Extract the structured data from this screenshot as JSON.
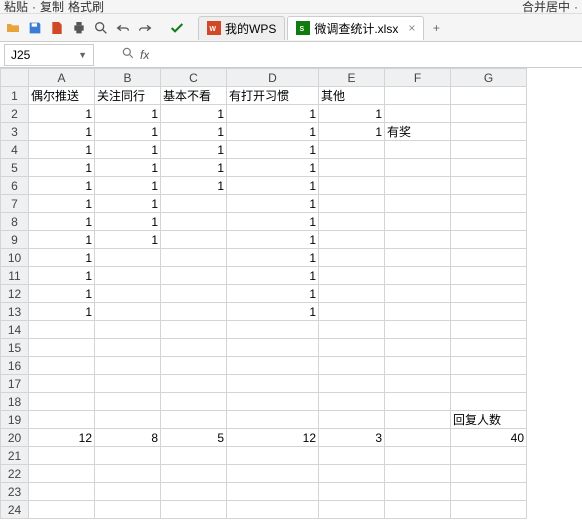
{
  "menu": {
    "paste": "粘贴",
    "copy": "复制",
    "brush": "格式刷",
    "merge_label": "合并居中"
  },
  "colors": {
    "accent": "#d24726",
    "green": "#107c10"
  },
  "tabs": {
    "t1": {
      "label": "我的WPS"
    },
    "t2": {
      "label": "微调查统计.xlsx"
    },
    "add": "+"
  },
  "namebox": {
    "value": "J25"
  },
  "fx": {
    "label": "fx"
  },
  "formula": {
    "value": ""
  },
  "cols": {
    "A": "A",
    "B": "B",
    "C": "C",
    "D": "D",
    "E": "E",
    "F": "F",
    "G": "G"
  },
  "rows": [
    "1",
    "2",
    "3",
    "4",
    "5",
    "6",
    "7",
    "8",
    "9",
    "10",
    "11",
    "12",
    "13",
    "14",
    "15",
    "16",
    "17",
    "18",
    "19",
    "20",
    "21",
    "22",
    "23",
    "24"
  ],
  "headers": {
    "A": "偶尔推送",
    "B": "关注同行",
    "C": "基本不看",
    "D": "有打开习惯",
    "E": "其他"
  },
  "cells": {
    "r2": {
      "A": "1",
      "B": "1",
      "C": "1",
      "D": "1",
      "E": "1"
    },
    "r3": {
      "A": "1",
      "B": "1",
      "C": "1",
      "D": "1",
      "E": "1",
      "F": "有奖"
    },
    "r4": {
      "A": "1",
      "B": "1",
      "C": "1",
      "D": "1"
    },
    "r5": {
      "A": "1",
      "B": "1",
      "C": "1",
      "D": "1"
    },
    "r6": {
      "A": "1",
      "B": "1",
      "C": "1",
      "D": "1"
    },
    "r7": {
      "A": "1",
      "B": "1",
      "D": "1"
    },
    "r8": {
      "A": "1",
      "B": "1",
      "D": "1"
    },
    "r9": {
      "A": "1",
      "B": "1",
      "D": "1"
    },
    "r10": {
      "A": "1",
      "D": "1"
    },
    "r11": {
      "A": "1",
      "D": "1"
    },
    "r12": {
      "A": "1",
      "D": "1"
    },
    "r13": {
      "A": "1",
      "D": "1"
    },
    "r19": {
      "G": "回复人数"
    },
    "r20": {
      "A": "12",
      "B": "8",
      "C": "5",
      "D": "12",
      "E": "3",
      "G": "40"
    }
  }
}
